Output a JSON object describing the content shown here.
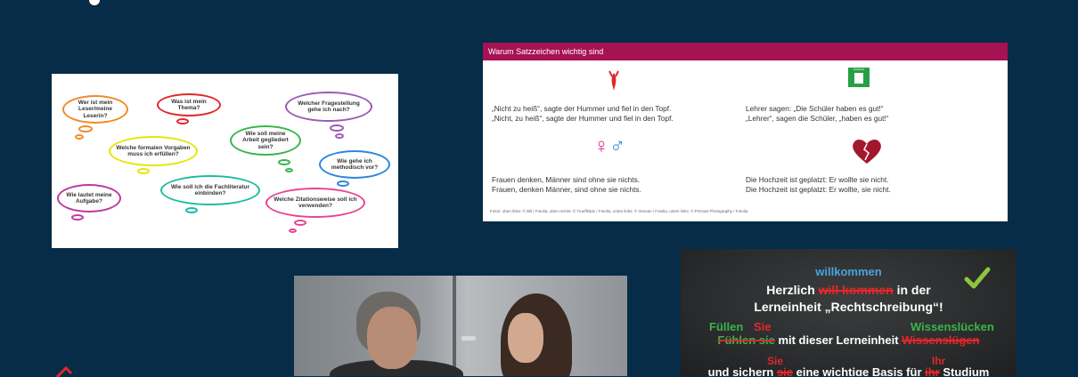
{
  "card1": {
    "bubbles": [
      {
        "text": "Wer ist mein Leser/meine Leserin?",
        "color": "#f28a2a"
      },
      {
        "text": "Was ist mein Thema?",
        "color": "#e0282a"
      },
      {
        "text": "Welcher Fragestellung gehe ich nach?",
        "color": "#9b59b6"
      },
      {
        "text": "Welche formalen Vorgaben muss ich erfüllen?",
        "color": "#e6e600"
      },
      {
        "text": "Wie soll meine Arbeit gegliedert sein?",
        "color": "#39b54a"
      },
      {
        "text": "Wie gehe ich methodisch vor?",
        "color": "#2e86de"
      },
      {
        "text": "Wie lautet meine Aufgabe?",
        "color": "#c0399f"
      },
      {
        "text": "Wie soll ich die Fachliteratur einbinden?",
        "color": "#1abc9c"
      },
      {
        "text": "Welche Zitationsweise soll ich verwenden?",
        "color": "#e84393"
      }
    ]
  },
  "card2": {
    "title": "Warum Satzzeichen wichtig sind",
    "header_color": "#a61252",
    "blocks": [
      {
        "line1": "„Nicht zu heiß“, sagte der Hummer und fiel in den Topf.",
        "line2": "„Nicht, zu heiß“, sagte der Hummer und fiel in den Topf."
      },
      {
        "line1": "Lehrer sagen: „Die Schüler haben es gut!“",
        "line2": "„Lehrer“, sagen die Schüler, „haben es gut!“"
      },
      {
        "line1": "Frauen denken, Männer sind ohne sie nichts.",
        "line2": "Frauen, denken Männer, sind ohne sie nichts."
      },
      {
        "line1": "Die Hochzeit ist geplatzt: Er wollte sie nicht.",
        "line2": "Die Hochzeit ist geplatzt: Er wollte, sie nicht."
      }
    ],
    "exit_sign_label": "SCHULE",
    "credit": "Fotos: oben links: © Bill / Fotolia, oben rechts: © Trueffelpix / Fotolia, unten links: © remsan / Fotolia, unten links: © PIXXart Photography / Fotolia"
  },
  "card4": {
    "word_correct_1": "willkommen",
    "line1_pre": "Herzlich ",
    "line1_strike": "will kommen",
    "line1_post": " in der",
    "line2": "Lerneinheit „Rechtschreibung“!",
    "line3_fix_a": "Füllen",
    "line3_fix_b": "Sie",
    "line3_fix_c": "Wissenslücken",
    "line4_strike_a": "Fühlen sie",
    "line4_mid": " mit dieser Lerneinheit ",
    "line4_strike_b": "Wissenslügen",
    "line5_fix_a": "Sie",
    "line5_fix_b": "Ihr",
    "line6_pre": "und sichern ",
    "line6_strike_a": "sie",
    "line6_mid": " eine wichtige Basis für ",
    "line6_strike_b": "ihr",
    "line6_post": " Studium"
  }
}
